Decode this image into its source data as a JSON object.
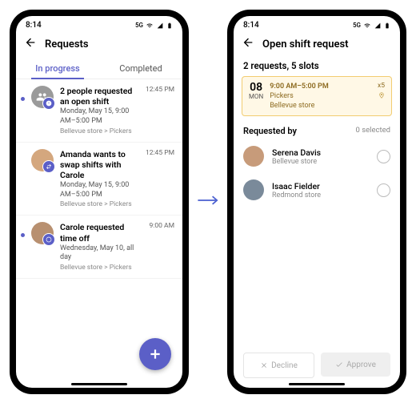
{
  "status": {
    "time": "8:14",
    "net": "5G"
  },
  "left": {
    "title": "Requests",
    "tabs": {
      "inprogress": "In progress",
      "completed": "Completed"
    },
    "items": [
      {
        "title": "2 people requested an open shift",
        "sub": "Monday, May 15, 9:00 AM–5:00 PM",
        "meta": "Bellevue store > Pickers",
        "time": "12:45 PM"
      },
      {
        "title": "Amanda wants to swap shifts with Carole",
        "sub": "Monday, May 15, 9:00 AM–5:00 PM",
        "meta": "Bellevue store > Pickers",
        "time": "12:45 PM"
      },
      {
        "title": "Carole requested time off",
        "sub": "Wednesday, May 10, all day",
        "meta": "Bellevue store > Pickers",
        "time": "9:00 AM"
      }
    ]
  },
  "right": {
    "title": "Open shift request",
    "summary": "2 requests, 5 slots",
    "shift": {
      "day": "08",
      "dow": "MON",
      "time": "9:00 AM–5:00 PM",
      "team": "Pickers",
      "store": "Bellevue store",
      "count": "x5"
    },
    "requested_by_label": "Requested by",
    "selected": "0 selected",
    "people": [
      {
        "name": "Serena Davis",
        "store": "Bellevue store"
      },
      {
        "name": "Isaac Fielder",
        "store": "Redmond store"
      }
    ],
    "decline": "Decline",
    "approve": "Approve"
  }
}
